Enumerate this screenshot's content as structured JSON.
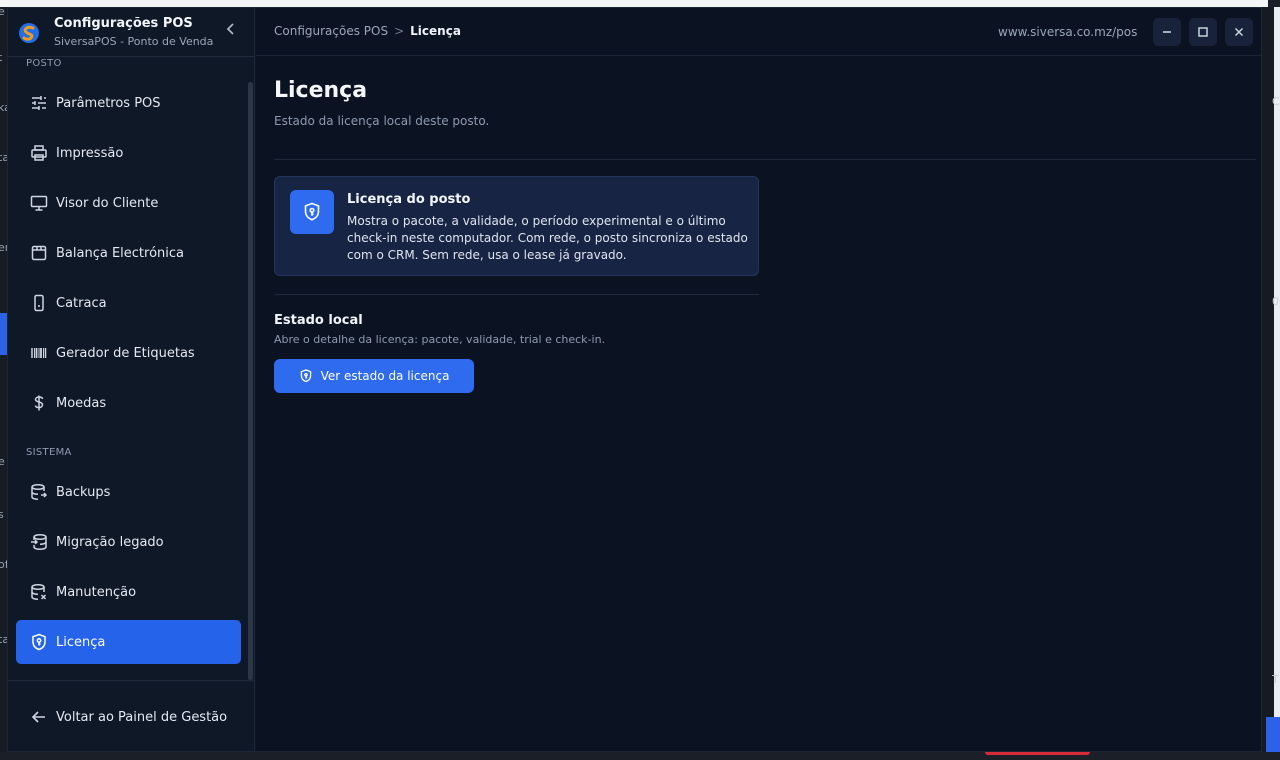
{
  "app": {
    "title": "Configurações POS",
    "subtitle": "SiversaPOS - Ponto de Venda",
    "url": "www.siversa.co.mz/pos"
  },
  "breadcrumb": {
    "parent": "Configurações POS",
    "separator": ">",
    "current": "Licença"
  },
  "sidebar": {
    "section_posto": "POSTO",
    "section_sistema": "SISTEMA",
    "items": [
      {
        "label": "Parâmetros POS",
        "icon": "sliders-icon"
      },
      {
        "label": "Impressão",
        "icon": "printer-icon"
      },
      {
        "label": "Visor do Cliente",
        "icon": "monitor-icon"
      },
      {
        "label": "Balança Electrónica",
        "icon": "scale-icon"
      },
      {
        "label": "Catraca",
        "icon": "turnstile-icon"
      },
      {
        "label": "Gerador de Etiquetas",
        "icon": "barcode-icon"
      },
      {
        "label": "Moedas",
        "icon": "dollar-icon"
      },
      {
        "label": "Backups",
        "icon": "database-backup-icon"
      },
      {
        "label": "Migração legado",
        "icon": "database-import-icon"
      },
      {
        "label": "Manutenção",
        "icon": "database-x-icon"
      },
      {
        "label": "Licença",
        "icon": "shield-key-icon",
        "active": true
      }
    ],
    "back_label": "Voltar ao Painel de Gestão"
  },
  "page": {
    "title": "Licença",
    "subtitle": "Estado da licença local deste posto."
  },
  "info_card": {
    "title": "Licença do posto",
    "body": "Mostra o pacote, a validade, o período experimental e o último check-in neste computador. Com rede, o posto sincroniza o estado com o CRM. Sem rede, usa o lease já gravado."
  },
  "local_state": {
    "title": "Estado local",
    "subtitle": "Abre o detalhe da licença: pacote, validade, trial e check-in.",
    "button_label": "Ver estado da licença"
  },
  "colors": {
    "accent": "#2563eb",
    "sidebar_bg": "#0f1827",
    "main_bg": "#0b1322",
    "card_bg": "#172443"
  }
}
